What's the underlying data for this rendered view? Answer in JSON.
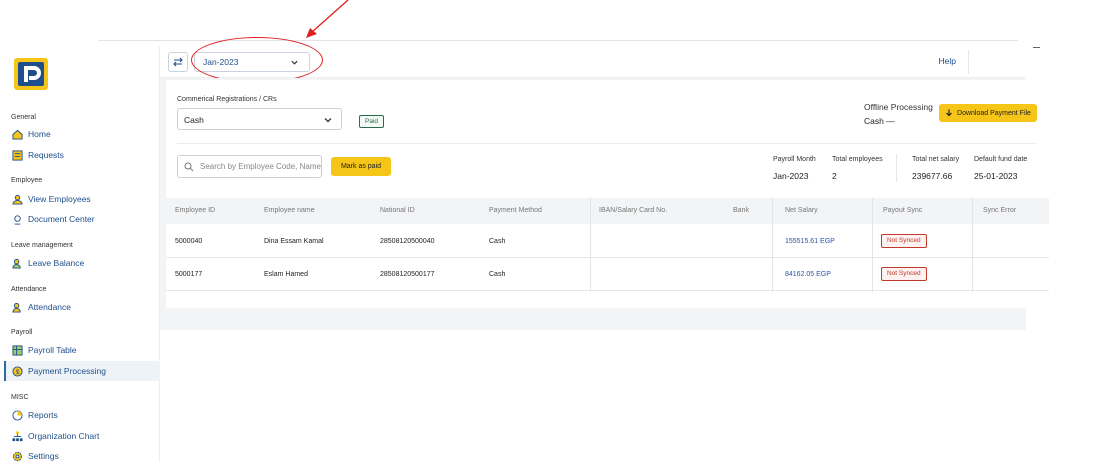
{
  "header": {
    "month": "Jan-2023",
    "help": "Help"
  },
  "sidebar": {
    "sections": [
      {
        "title": "General",
        "items": [
          {
            "label": "Home",
            "icon": "home-icon"
          },
          {
            "label": "Requests",
            "icon": "requests-icon"
          }
        ]
      },
      {
        "title": "Employee",
        "items": [
          {
            "label": "View Employees",
            "icon": "employees-icon"
          },
          {
            "label": "Document Center",
            "icon": "document-icon"
          }
        ]
      },
      {
        "title": "Leave management",
        "items": [
          {
            "label": "Leave Balance",
            "icon": "leave-icon"
          }
        ]
      },
      {
        "title": "Attendance",
        "items": [
          {
            "label": "Attendance",
            "icon": "attendance-icon"
          }
        ]
      },
      {
        "title": "Payroll",
        "items": [
          {
            "label": "Payroll Table",
            "icon": "payroll-table-icon"
          },
          {
            "label": "Payment Processing",
            "icon": "payment-icon",
            "active": true
          }
        ]
      },
      {
        "title": "MISC",
        "items": [
          {
            "label": "Reports",
            "icon": "reports-icon"
          },
          {
            "label": "Organization Chart",
            "icon": "org-chart-icon"
          },
          {
            "label": "Settings",
            "icon": "settings-icon"
          }
        ]
      }
    ]
  },
  "filters": {
    "cr_label": "Commerical Registrations / CRs",
    "cr_value": "Cash",
    "paid_badge": "Paid",
    "offline_title": "Offline Processing",
    "offline_value": "Cash —",
    "download_button": "Download Payment File",
    "search_placeholder": "Search by Employee Code, Name",
    "mark_paid_button": "Mark as paid"
  },
  "stats": {
    "payroll_month_label": "Payroll Month",
    "payroll_month": "Jan-2023",
    "total_employees_label": "Total employees",
    "total_employees": "2",
    "total_net_salary_label": "Total net salary",
    "total_net_salary": "239677.66",
    "default_fund_date_label": "Default fund date",
    "default_fund_date": "25-01-2023"
  },
  "table": {
    "columns": [
      "Employee ID",
      "Employee name",
      "National ID",
      "Payment Method",
      "IBAN/Salary Card No.",
      "Bank",
      "Net Salary",
      "Payout Sync",
      "Sync Error"
    ],
    "rows": [
      {
        "id": "5000040",
        "name": "Dina Essam Kamal",
        "national_id": "28508120500040",
        "method": "Cash",
        "iban": "",
        "bank": "",
        "net_salary": "155515.61 EGP",
        "sync": "Not Synced",
        "error": ""
      },
      {
        "id": "5000177",
        "name": "Eslam Hamed",
        "national_id": "28508120500177",
        "method": "Cash",
        "iban": "",
        "bank": "",
        "net_salary": "84162.05 EGP",
        "sync": "Not Synced",
        "error": ""
      }
    ]
  },
  "colors": {
    "accent": "#f5c518",
    "link": "#1f4e8c",
    "annotation": "#e02020"
  }
}
